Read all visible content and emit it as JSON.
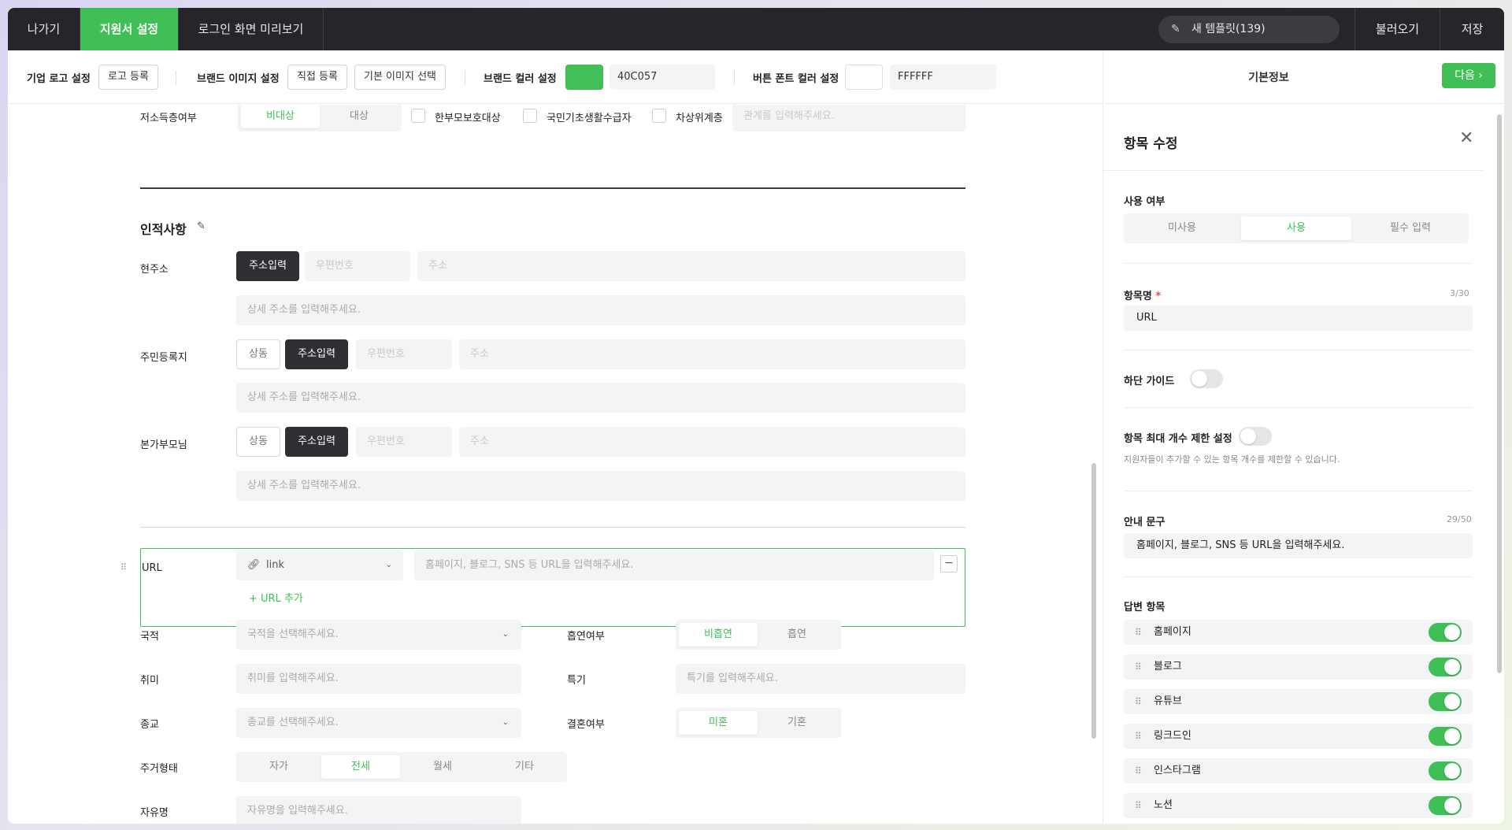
{
  "nav": {
    "exit": "나가기",
    "application_settings": "지원서 설정",
    "login_preview": "로그인 화면 미리보기",
    "template_button": "새 템플릿(139)",
    "load": "불러오기",
    "save": "저장"
  },
  "settings_bar": {
    "logo_label": "기업 로고 설정",
    "logo_button": "로고 등록",
    "brand_image_label": "브랜드 이미지 설정",
    "direct_upload": "직접 등록",
    "default_image": "기본 이미지 선택",
    "brand_color_label": "브랜드 컬러 설정",
    "brand_color": "#40C057",
    "brand_color_hex": "40C057",
    "button_font_color_label": "버튼 폰트 컬러 설정",
    "button_font_color": "#FFFFFF",
    "button_font_color_hex": "FFFFFF"
  },
  "right_header": {
    "title": "기본정보",
    "next": "다음"
  },
  "form": {
    "low_income": {
      "label": "저소득층여부",
      "options": [
        "비대상",
        "대상"
      ],
      "selected": "비대상",
      "checks": [
        "한부모보호대상",
        "국민기초생활수급자",
        "차상위계층"
      ],
      "relation_placeholder": "관계를 입력해주세요."
    },
    "section_title": "인적사항",
    "current_address": {
      "label": "현주소",
      "search": "주소입력",
      "postcode": "우편번호",
      "address": "주소",
      "detail": "상세 주소를 입력해주세요."
    },
    "registered_address": {
      "label": "주민등록지",
      "same": "상동",
      "search": "주소입력",
      "postcode": "우편번호",
      "address": "주소",
      "detail": "상세 주소를 입력해주세요."
    },
    "parents_address": {
      "label": "본가부모님",
      "same": "상동",
      "search": "주소입력",
      "postcode": "우편번호",
      "address": "주소",
      "detail": "상세 주소를 입력해주세요."
    },
    "url": {
      "label": "URL",
      "type": "link",
      "placeholder": "홈페이지, 블로그, SNS 등 URL을 입력해주세요.",
      "add": "URL 추가"
    },
    "nationality": {
      "label": "국적",
      "placeholder": "국적을 선택해주세요."
    },
    "smoking": {
      "label": "흡연여부",
      "options": [
        "비흡연",
        "흡연"
      ],
      "selected": "비흡연"
    },
    "hobby": {
      "label": "취미",
      "placeholder": "취미를 입력해주세요."
    },
    "specialty": {
      "label": "특기",
      "placeholder": "특기를 입력해주세요."
    },
    "religion": {
      "label": "종교",
      "placeholder": "종교를 선택해주세요."
    },
    "marriage": {
      "label": "결혼여부",
      "options": [
        "미혼",
        "기혼"
      ],
      "selected": "미혼"
    },
    "housing": {
      "label": "주거형태",
      "options": [
        "자가",
        "전세",
        "월세",
        "기타"
      ],
      "selected": "전세"
    },
    "next_row": {
      "label": "자유명",
      "placeholder": "자유명을 입력해주세요."
    }
  },
  "edit_panel": {
    "title": "항목 수정",
    "usage_label": "사용 여부",
    "usage_options": [
      "미사용",
      "사용",
      "필수 입력"
    ],
    "usage_selected": "사용",
    "name_label": "항목명",
    "required_mark": "*",
    "name_count": "3/30",
    "name_value": "URL",
    "bottom_guide_label": "하단 가이드",
    "bottom_guide_on": false,
    "max_limit_label": "항목 최대 개수 제한 설정",
    "max_limit_on": false,
    "max_limit_desc": "지원자들이 추가할 수 있는 항목 개수를 제한할 수 있습니다.",
    "guide_label": "안내 문구",
    "guide_count": "29/50",
    "guide_value": "홈페이지, 블로그, SNS 등 URL을 입력해주세요.",
    "answers_label": "답변 항목",
    "answers": [
      {
        "name": "홈페이지",
        "on": true
      },
      {
        "name": "블로그",
        "on": true
      },
      {
        "name": "유튜브",
        "on": true
      },
      {
        "name": "링크드인",
        "on": true
      },
      {
        "name": "인스타그램",
        "on": true
      },
      {
        "name": "노션",
        "on": true
      }
    ]
  },
  "colors": {
    "accent": "#3FBF55",
    "nav_bg": "#24262A"
  }
}
